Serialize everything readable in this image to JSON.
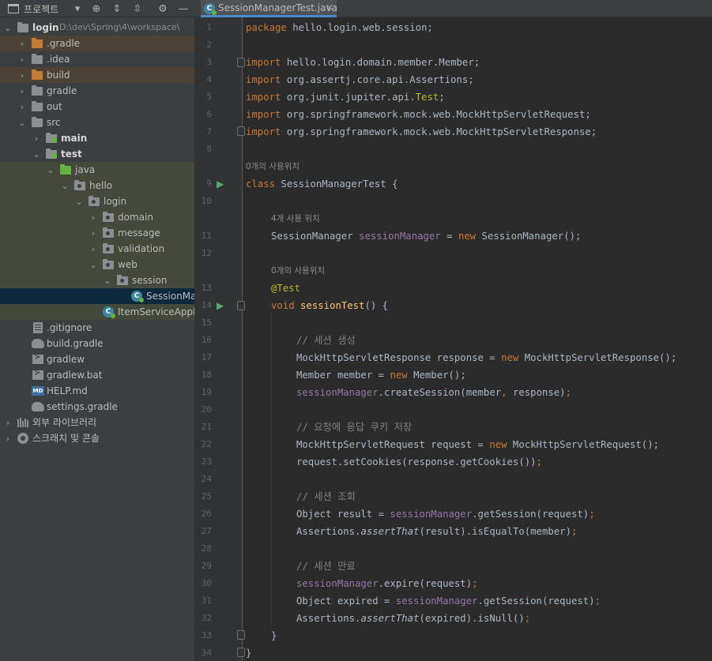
{
  "project_panel": {
    "title": "프로젝트",
    "tree": [
      {
        "label": "login",
        "sub": "D:\\dev\\Spring\\4\\workspace\\",
        "bold": true
      },
      {
        "label": ".gradle"
      },
      {
        "label": ".idea"
      },
      {
        "label": "build"
      },
      {
        "label": "gradle"
      },
      {
        "label": "out"
      },
      {
        "label": "src"
      },
      {
        "label": "main",
        "bold": true
      },
      {
        "label": "test",
        "bold": true
      },
      {
        "label": "java"
      },
      {
        "label": "hello"
      },
      {
        "label": "login"
      },
      {
        "label": "domain"
      },
      {
        "label": "message"
      },
      {
        "label": "validation"
      },
      {
        "label": "web"
      },
      {
        "label": "session"
      },
      {
        "label": "SessionManagerTest"
      },
      {
        "label": "ItemServiceApplicationTests"
      },
      {
        "label": ".gitignore"
      },
      {
        "label": "build.gradle"
      },
      {
        "label": "gradlew"
      },
      {
        "label": "gradlew.bat"
      },
      {
        "label": "HELP.md"
      },
      {
        "label": "settings.gradle"
      },
      {
        "label": "외부 라이브러리"
      },
      {
        "label": "스크래치 및 콘솔"
      }
    ]
  },
  "editor": {
    "tab_label": "SessionManagerTest.java",
    "class_icon_letter": "C",
    "line_numbers": [
      "1",
      "2",
      "3",
      "4",
      "5",
      "6",
      "7",
      "8",
      "9",
      "10",
      "11",
      "12",
      "13",
      "14",
      "15",
      "16",
      "17",
      "18",
      "19",
      "20",
      "21",
      "22",
      "23",
      "24",
      "25",
      "26",
      "27",
      "28",
      "29",
      "30",
      "31",
      "32",
      "33",
      "34"
    ],
    "hints": {
      "class_usages": "0개의 사용위치",
      "field_usages": "4개 사용 위치",
      "method_usages": "0개의 사용위치"
    },
    "code": {
      "package_kw": "package",
      "package_name": " hello.login.web.session;",
      "import_kw": "import",
      "import_member": " hello.login.domain.member.Member;",
      "import_assertions": " org.assertj.core.api.Assertions;",
      "import_test_pre": " org.junit.jupiter.api.",
      "import_test_cls": "Test",
      "import_test_post": ";",
      "import_req": " org.springframework.mock.web.MockHttpServletRequest;",
      "import_res": " org.springframework.mock.web.MockHttpServletResponse;",
      "class_kw": "class",
      "class_decl": " SessionManagerTest {",
      "field_type": "SessionManager ",
      "field_name": "sessionManager",
      "eq": " = ",
      "new_kw": "new",
      "field_init": " SessionManager();",
      "annotation": "@Test",
      "void_kw": "void",
      "method_name": "sessionTest",
      "method_sig": "() {",
      "c_create": "// 세션 생성",
      "l17a": "MockHttpServletResponse response = ",
      "l17b": " MockHttpServletResponse();",
      "l18a": "Member member = ",
      "l18b": " Member();",
      "l19b": ".createSession(member",
      "l19c": ",",
      "l19d": " response)",
      "semi": ";",
      "c_request": "// 요청에 응답 쿠키 저장",
      "l22a": "MockHttpServletRequest request = ",
      "l22b": " MockHttpServletRequest();",
      "l23a": "request.setCookies(response.getCookies())",
      "c_lookup": "// 세션 조회",
      "l26a": "Object result = ",
      "l26b": ".getSession(request)",
      "l27a": "Assertions.",
      "assert_that": "assertThat",
      "l27b": "(result).isEqualTo(member)",
      "c_expire": "// 세션 만료",
      "l30b": ".expire(request)",
      "l31a": "Object expired = ",
      "l32b": "(expired).isNull()",
      "close1": "}",
      "close0": "}"
    }
  }
}
